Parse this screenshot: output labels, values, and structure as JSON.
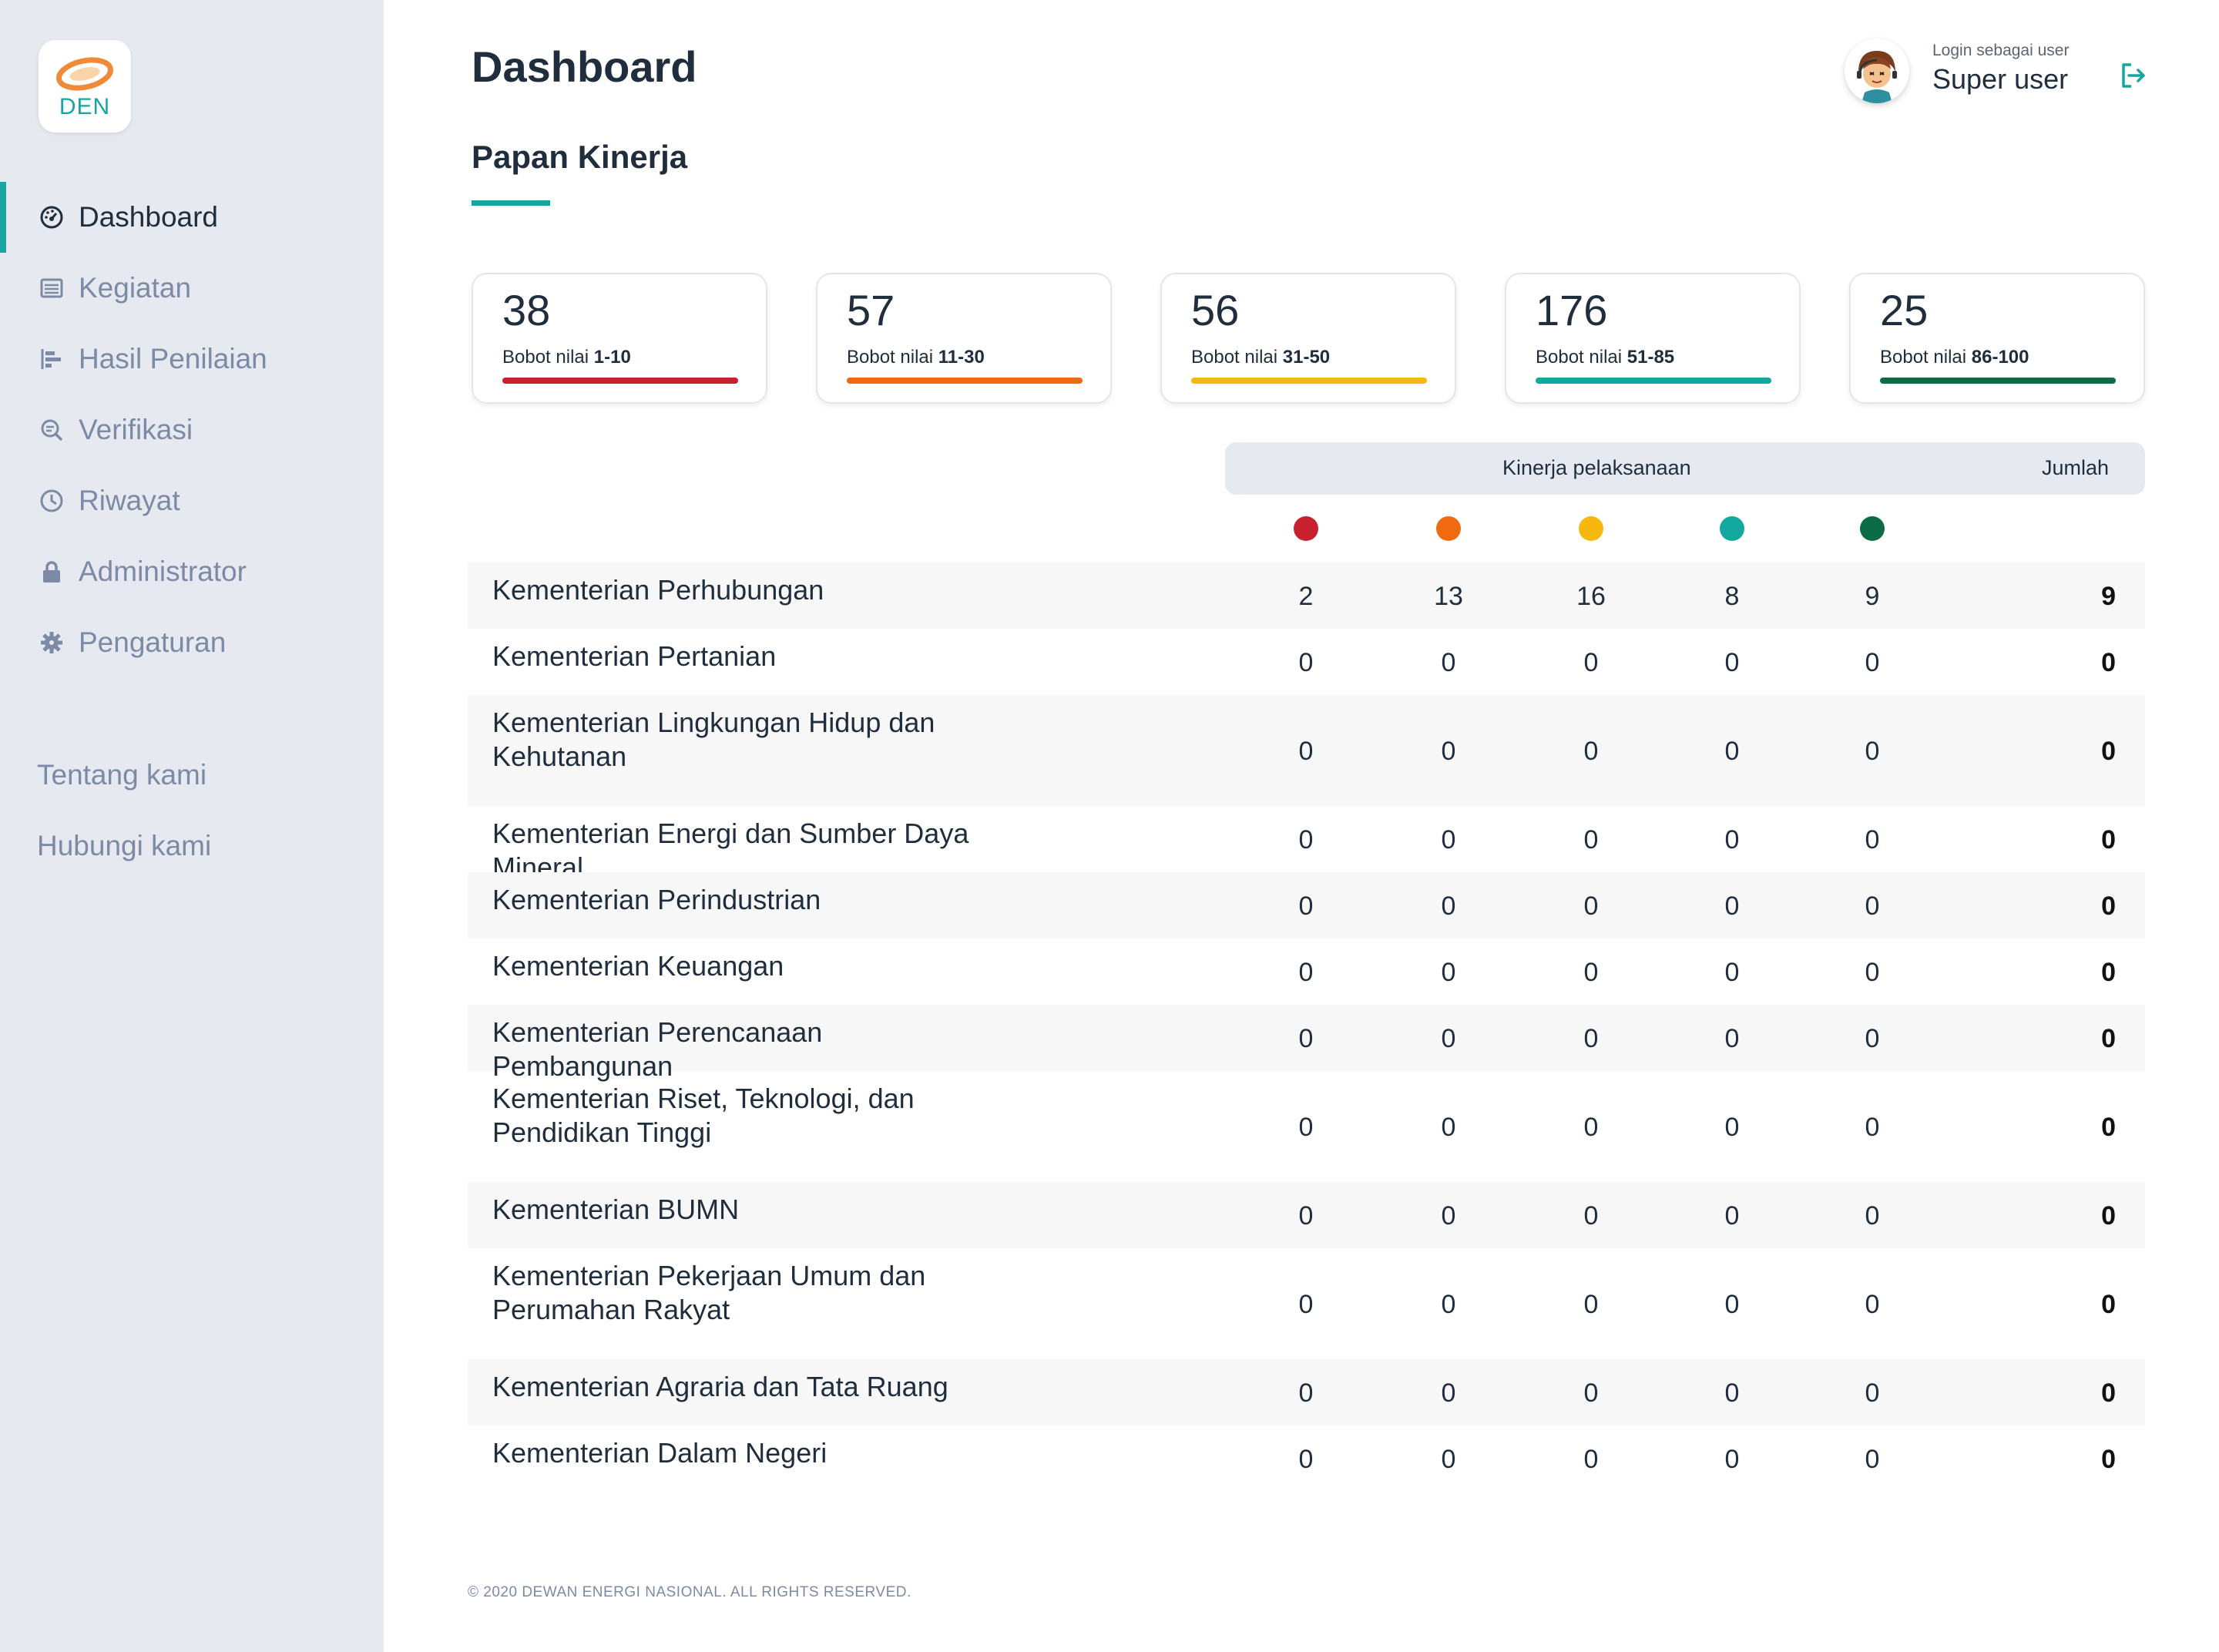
{
  "brand": {
    "logo_text": "DEN",
    "accent_color": "#16a5a0"
  },
  "sidebar": {
    "items": [
      {
        "label": "Dashboard",
        "icon": "dashboard-icon",
        "active": true
      },
      {
        "label": "Kegiatan",
        "icon": "list-icon",
        "active": false
      },
      {
        "label": "Hasil Penilaian",
        "icon": "bar-chart-icon",
        "active": false
      },
      {
        "label": "Verifikasi",
        "icon": "search-doc-icon",
        "active": false
      },
      {
        "label": "Riwayat",
        "icon": "clock-icon",
        "active": false
      },
      {
        "label": "Administrator",
        "icon": "lock-icon",
        "active": false
      },
      {
        "label": "Pengaturan",
        "icon": "gear-icon",
        "active": false
      }
    ],
    "secondary": [
      "Tentang kami",
      "Hubungi kami"
    ]
  },
  "header": {
    "title": "Dashboard",
    "subtitle": "Papan Kinerja",
    "login_label": "Login sebagai user",
    "user_name": "Super user"
  },
  "cards": [
    {
      "count": "38",
      "label": "Bobot nilai ",
      "range": "1-10",
      "color": "#c8202f"
    },
    {
      "count": "57",
      "label": "Bobot nilai ",
      "range": "11-30",
      "color": "#ef6a10"
    },
    {
      "count": "56",
      "label": "Bobot nilai ",
      "range": "31-50",
      "color": "#f6b80f"
    },
    {
      "count": "176",
      "label": "Bobot nilai ",
      "range": "51-85",
      "color": "#13a89e"
    },
    {
      "count": "25",
      "label": "Bobot nilai ",
      "range": "86-100",
      "color": "#0b6b47"
    }
  ],
  "table": {
    "header_kinerja": "Kinerja pelaksanaan",
    "header_jumlah": "Jumlah",
    "dot_colors": [
      "#c8202f",
      "#ef6a10",
      "#f6b80f",
      "#13a89e",
      "#0b6b47"
    ],
    "rows": [
      {
        "name": "Kementerian Perhubungan",
        "values": [
          "2",
          "13",
          "16",
          "8",
          "9"
        ],
        "total": "9"
      },
      {
        "name": "Kementerian Pertanian",
        "values": [
          "0",
          "0",
          "0",
          "0",
          "0"
        ],
        "total": "0"
      },
      {
        "name": "Kementerian Lingkungan Hidup dan Kehutanan",
        "values": [
          "0",
          "0",
          "0",
          "0",
          "0"
        ],
        "total": "0"
      },
      {
        "name": "Kementerian Energi dan Sumber Daya Mineral",
        "values": [
          "0",
          "0",
          "0",
          "0",
          "0"
        ],
        "total": "0"
      },
      {
        "name": "Kementerian Perindustrian",
        "values": [
          "0",
          "0",
          "0",
          "0",
          "0"
        ],
        "total": "0"
      },
      {
        "name": "Kementerian Keuangan",
        "values": [
          "0",
          "0",
          "0",
          "0",
          "0"
        ],
        "total": "0"
      },
      {
        "name": "Kementerian Perencanaan Pembangunan",
        "values": [
          "0",
          "0",
          "0",
          "0",
          "0"
        ],
        "total": "0"
      },
      {
        "name": "Kementerian Riset, Teknologi, dan Pendidikan Tinggi",
        "values": [
          "0",
          "0",
          "0",
          "0",
          "0"
        ],
        "total": "0"
      },
      {
        "name": "Kementerian BUMN",
        "values": [
          "0",
          "0",
          "0",
          "0",
          "0"
        ],
        "total": "0"
      },
      {
        "name": "Kementerian Pekerjaan Umum dan Perumahan Rakyat",
        "values": [
          "0",
          "0",
          "0",
          "0",
          "0"
        ],
        "total": "0"
      },
      {
        "name": "Kementerian Agraria dan Tata Ruang",
        "values": [
          "0",
          "0",
          "0",
          "0",
          "0"
        ],
        "total": "0"
      },
      {
        "name": "Kementerian Dalam Negeri",
        "values": [
          "0",
          "0",
          "0",
          "0",
          "0"
        ],
        "total": "0"
      }
    ]
  },
  "footer": "© 2020 DEWAN ENERGI NASIONAL. ALL RIGHTS RESERVED."
}
